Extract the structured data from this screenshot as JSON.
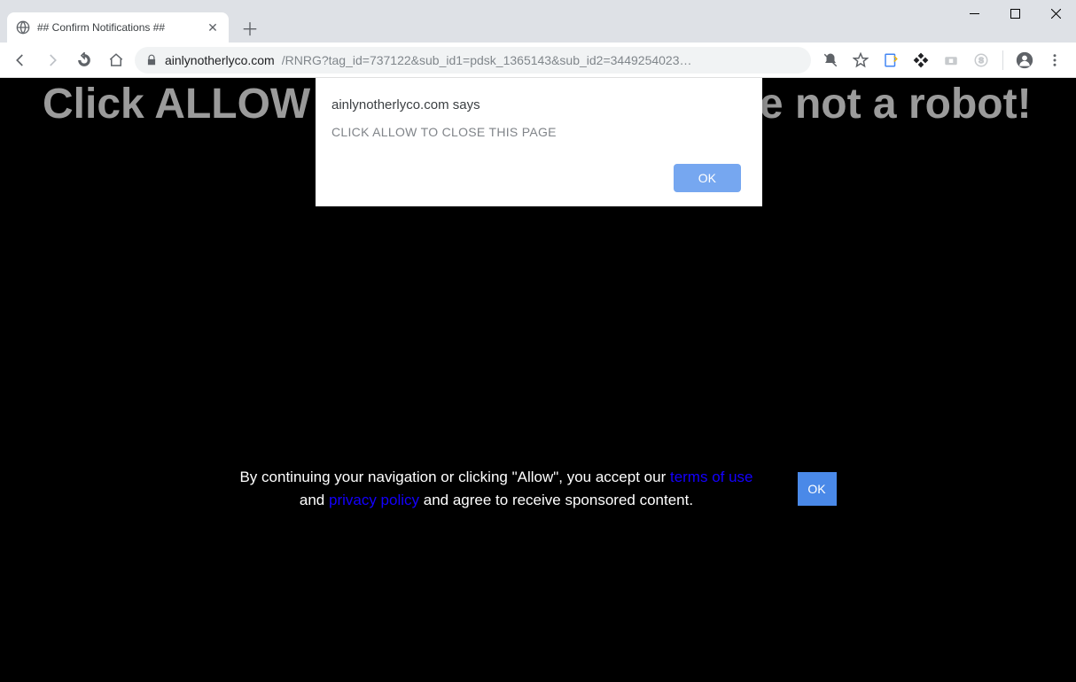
{
  "tab": {
    "title": "## Confirm Notifications ##"
  },
  "address": {
    "domain": "ainlynotherlyco.com",
    "path": "/RNRG?tag_id=737122&sub_id1=pdsk_1365143&sub_id2=3449254023…"
  },
  "page": {
    "heading": "Click ALLOW to confirm that you are not a robot!"
  },
  "dialog": {
    "origin": "ainlynotherlyco.com says",
    "message": "CLICK ALLOW TO CLOSE THIS PAGE",
    "ok": "OK"
  },
  "consent": {
    "prefix": "By continuing your navigation or clicking \"Allow\", you accept our ",
    "terms": "terms of use",
    "between": " and ",
    "privacy": "privacy policy",
    "suffix": " and agree to receive sponsored content.",
    "ok": "OK"
  }
}
